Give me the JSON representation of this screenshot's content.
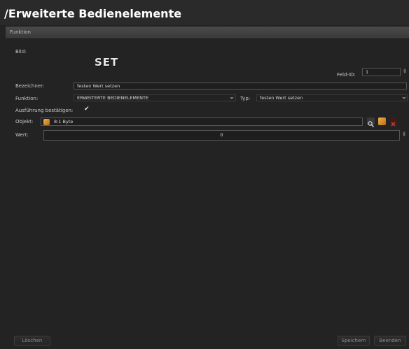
{
  "window": {
    "title": "/Erweiterte Bedienelemente"
  },
  "section": {
    "label": "Funktion"
  },
  "form": {
    "bild_label": "Bild:",
    "bild_text": "SET",
    "feld_id_label": "Feld-ID:",
    "feld_id_value": "1",
    "bezeichner_label": "Bezeichner:",
    "bezeichner_value": "festen Wert setzen",
    "funktion_label": "Funktion:",
    "funktion_value": "ERWEITERTE BEDIENELEMENTE",
    "typ_label": "Typ:",
    "typ_value": "festen Wert setzen",
    "bestaetigen_label": "Ausführung bestätigen:",
    "bestaetigen_checked": true,
    "objekt_label": "Objekt:",
    "objekt_value": "8:1 Byte",
    "wert_label": "Wert:",
    "wert_value": "0"
  },
  "buttons": {
    "delete": "Löschen",
    "save": "Speichern",
    "quit": "Beenden"
  },
  "colors": {
    "background": "#232323",
    "remove_icon": "#c0392b",
    "object_icon": "#e08a2a"
  }
}
